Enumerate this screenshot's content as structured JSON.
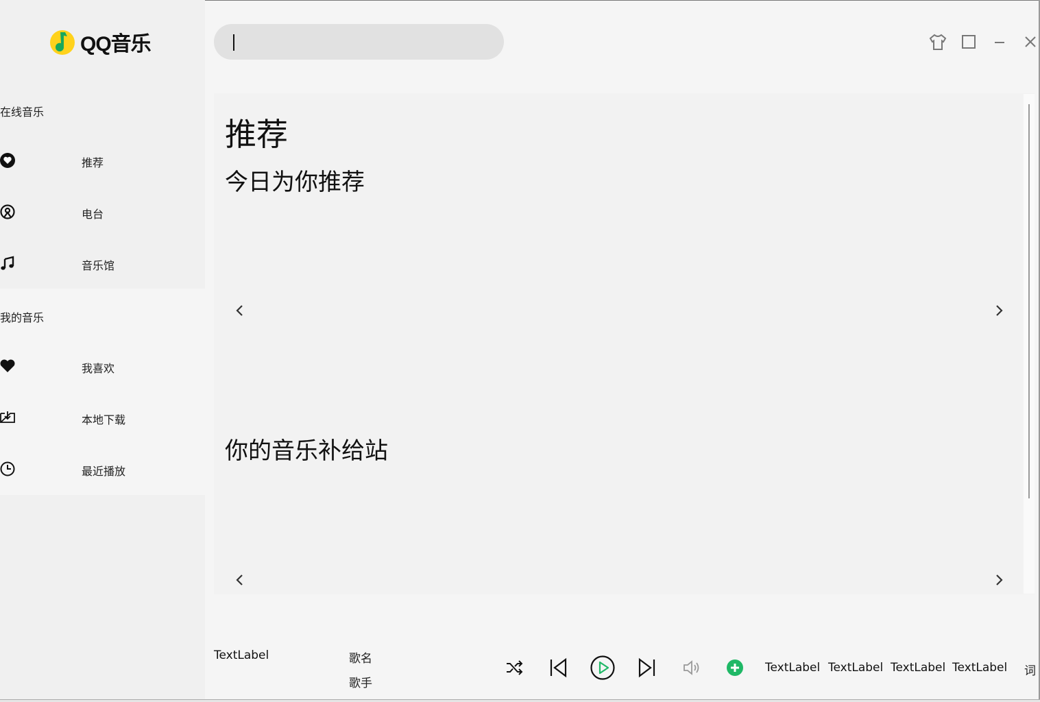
{
  "app": {
    "logo_text": "QQ音乐"
  },
  "search": {
    "value": ""
  },
  "sidebar": {
    "online_label": "在线音乐",
    "online_items": [
      {
        "icon": "heart-circle-icon",
        "label": "推荐"
      },
      {
        "icon": "radio-icon",
        "label": "电台"
      },
      {
        "icon": "music-note-icon",
        "label": "音乐馆"
      }
    ],
    "mine_label": "我的音乐",
    "mine_items": [
      {
        "icon": "heart-icon",
        "label": "我喜欢"
      },
      {
        "icon": "download-icon",
        "label": "本地下载"
      },
      {
        "icon": "clock-icon",
        "label": "最近播放"
      }
    ]
  },
  "window_controls": [
    "skin-icon",
    "maximize-icon",
    "minimize-icon",
    "close-icon"
  ],
  "main": {
    "title": "推荐",
    "section1_title": "今日为你推荐",
    "section2_title": "你的音乐补给站"
  },
  "player": {
    "cover_label": "TextLabel",
    "song_name": "歌名",
    "artist": "歌手",
    "labels": [
      "TextLabel",
      "TextLabel",
      "TextLabel",
      "TextLabel"
    ],
    "lyrics_label": "词",
    "accent_color": "#1fb866"
  }
}
